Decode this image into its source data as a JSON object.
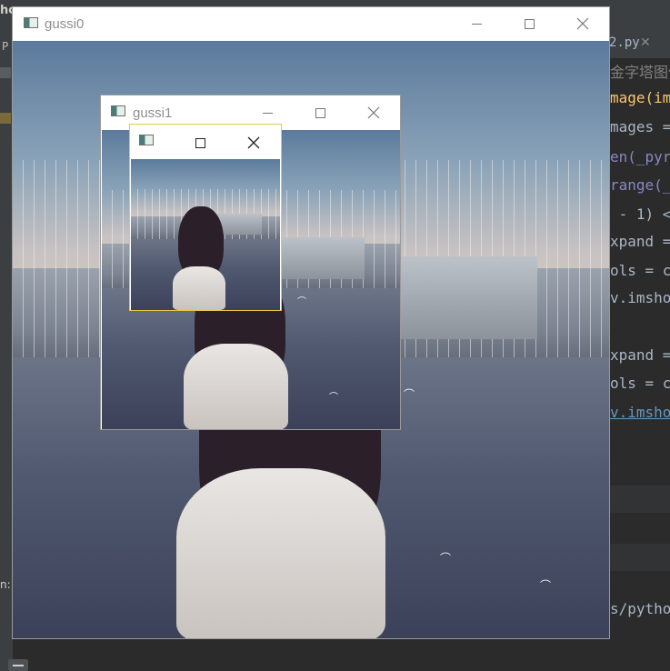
{
  "ide": {
    "top_left_text": "ho",
    "left_p": "P",
    "tab_label": "2.py",
    "tab_close": "✕",
    "bottom_left_text": "n:",
    "code_lines": [
      {
        "text": "金字塔图像",
        "color": "#808080"
      },
      {
        "text": "mage(ima",
        "color": "#ffc66d"
      },
      {
        "text": "mages =",
        "color": "#a9b7c6"
      },
      {
        "text": "en(_pyra",
        "color": "#8888c6"
      },
      {
        "text": "range(_",
        "color": "#8888c6"
      },
      {
        "text": " - 1) <",
        "color": "#a9b7c6"
      },
      {
        "text": "xpand =",
        "color": "#a9b7c6"
      },
      {
        "text": "ols = cv",
        "color": "#a9b7c6"
      },
      {
        "text": "v.imshow",
        "color": "#a9b7c6"
      },
      {
        "text": "xpand =",
        "color": "#a9b7c6"
      },
      {
        "text": "ols = cv",
        "color": "#a9b7c6"
      },
      {
        "text": "v.imshow",
        "color": "#6897bb"
      },
      {
        "text": "s/pytho",
        "color": "#a9b7c6"
      }
    ]
  },
  "windows": {
    "gussi0": {
      "title": "gussi0"
    },
    "gussi1": {
      "title": "gussi1"
    },
    "gussi2": {
      "title": ""
    }
  },
  "icons": {
    "minimize": "minimize-icon",
    "maximize": "maximize-icon",
    "close": "close-icon",
    "app": "opencv-window-icon"
  },
  "colors": {
    "active_border": "#e3c94a",
    "ide_bg": "#2b2b2b"
  }
}
